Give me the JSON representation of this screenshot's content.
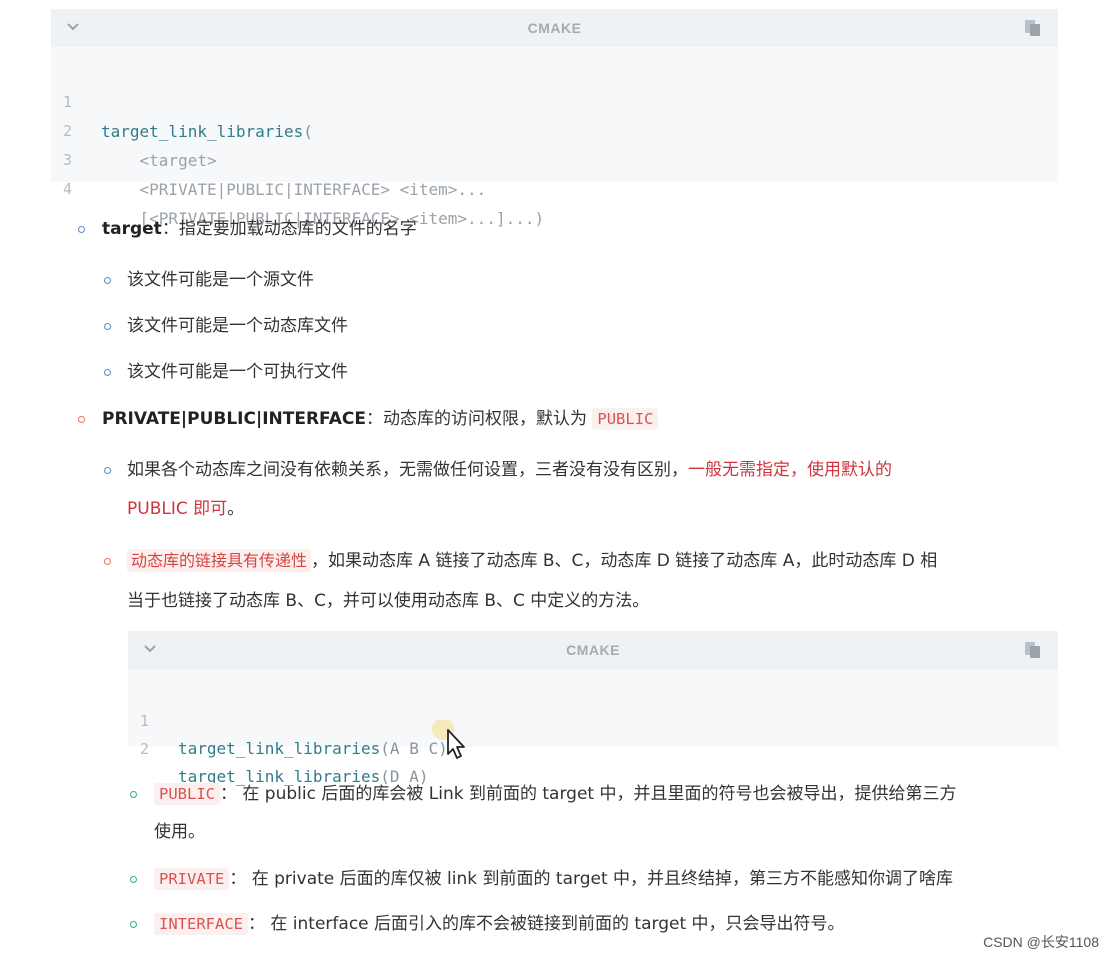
{
  "code_block_1": {
    "language": "CMAKE",
    "lines": [
      {
        "n": "1",
        "fn": "target_link_libraries",
        "rest": "("
      },
      {
        "n": "2",
        "fn": "",
        "rest": "    <target>"
      },
      {
        "n": "3",
        "fn": "",
        "rest": "    <PRIVATE|PUBLIC|INTERFACE> <item>..."
      },
      {
        "n": "4",
        "fn": "",
        "rest": "    [<PRIVATE|PUBLIC|INTERFACE> <item>...]...)"
      }
    ]
  },
  "items": {
    "target": {
      "term": "target",
      "desc": "：指定要加载动态库的文件的名字"
    },
    "target_sub": [
      "该文件可能是一个源文件",
      "该文件可能是一个动态库文件",
      "该文件可能是一个可执行文件"
    ],
    "access": {
      "term": "PRIVATE|PUBLIC|INTERFACE",
      "desc": "：动态库的访问权限，默认为 ",
      "code": "PUBLIC"
    },
    "access_sub1": {
      "text": "如果各个动态库之间没有依赖关系，无需做任何设置，三者没有没有区别，",
      "red": "一般无需指定，使用默认的",
      "line2_red": "PUBLIC 即可",
      "line2_end": "。"
    },
    "access_sub2": {
      "highlight": "动态库的链接具有传递性",
      "line1": "，如果动态库 A 链接了动态库 B、C，动态库 D 链接了动态库 A，此时动态库 D 相",
      "line2": "当于也链接了动态库 B、C，并可以使用动态库 B、C 中定义的方法。"
    }
  },
  "code_block_2": {
    "language": "CMAKE",
    "lines": [
      {
        "n": "1",
        "fn": "target_link_libraries",
        "rest": "(A B C)"
      },
      {
        "n": "2",
        "fn": "target_link_libraries",
        "rest": "(D A)"
      }
    ]
  },
  "keyword_items": {
    "public": {
      "code": "PUBLIC",
      "line1": "： 在 public 后面的库会被 Link 到前面的 target 中，并且里面的符号也会被导出，提供给第三方",
      "line2": "使用。"
    },
    "private": {
      "code": "PRIVATE",
      "line1": "： 在 private 后面的库仅被 link 到前面的 target 中，并且终结掉，第三方不能感知你调了啥库"
    },
    "interface": {
      "code": "INTERFACE",
      "line1": "： 在 interface 后面引入的库不会被链接到前面的 target 中，只会导出符号。"
    }
  },
  "watermark": "CSDN @长安1108",
  "icons": [
    "chevron-down-icon",
    "copy-icon",
    "mouse-cursor-icon"
  ]
}
